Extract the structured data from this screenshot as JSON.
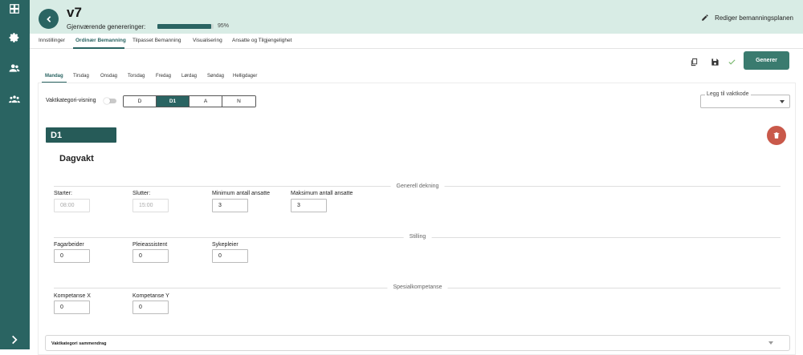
{
  "sidebar": {
    "icons": [
      "dashboard-icon",
      "gear-icon",
      "person-icon",
      "group-icon",
      "chevron-right-icon"
    ]
  },
  "header": {
    "title": "v7",
    "generations_label": "Gjenværende genereringer:",
    "generations_progress": 0.95,
    "generations_text": "95%",
    "edit_label": "Rediger bemanningsplanen"
  },
  "tabs": [
    "Innstillinger",
    "Ordinær Bemanning",
    "Tilpasset Bemanning",
    "Visualisering",
    "Ansatte og Tilgjengelighet"
  ],
  "active_tab": "Ordinær Bemanning",
  "toolbar": {
    "icons": [
      "copy-icon",
      "save-icon",
      "check-icon"
    ],
    "generate_label": "Generer"
  },
  "days": [
    "Mandag",
    "Tirsdag",
    "Onsdag",
    "Torsdag",
    "Fredag",
    "Lørdag",
    "Søndag",
    "Helligdager"
  ],
  "active_day": "Mandag",
  "category_toggle_label": "Vaktkategori-visning",
  "segments": [
    "D",
    "D1",
    "A",
    "N"
  ],
  "active_segment": "D1",
  "add_shift_code_label": "Legg til vaktkode",
  "shift": {
    "code": "D1",
    "name": "Dagvakt"
  },
  "sections": {
    "general": "Generell dekning",
    "position": "Stilling",
    "special": "Spesialkompetanse"
  },
  "general_fields": [
    {
      "label": "Starter:",
      "value": "08:00",
      "disabled": true
    },
    {
      "label": "Slutter:",
      "value": "15:00",
      "disabled": true
    },
    {
      "label": "Minimum antall ansatte",
      "value": "3",
      "disabled": false
    },
    {
      "label": "Maksimum antall ansatte",
      "value": "3",
      "disabled": false
    }
  ],
  "position_fields": [
    {
      "label": "Fagarbeider",
      "value": "0"
    },
    {
      "label": "Pleieassistent",
      "value": "0"
    },
    {
      "label": "Sykepleier",
      "value": "0"
    }
  ],
  "special_fields": [
    {
      "label": "Kompetanse X",
      "value": "0"
    },
    {
      "label": "Kompetanse Y",
      "value": "0"
    }
  ],
  "summary_label": "Vaktkategori sammendrag",
  "colors": {
    "brand": "#2a6462",
    "header_bg": "#d8ece5",
    "generate_button": "#3a7b6f",
    "delete_button": "#c9594a"
  }
}
